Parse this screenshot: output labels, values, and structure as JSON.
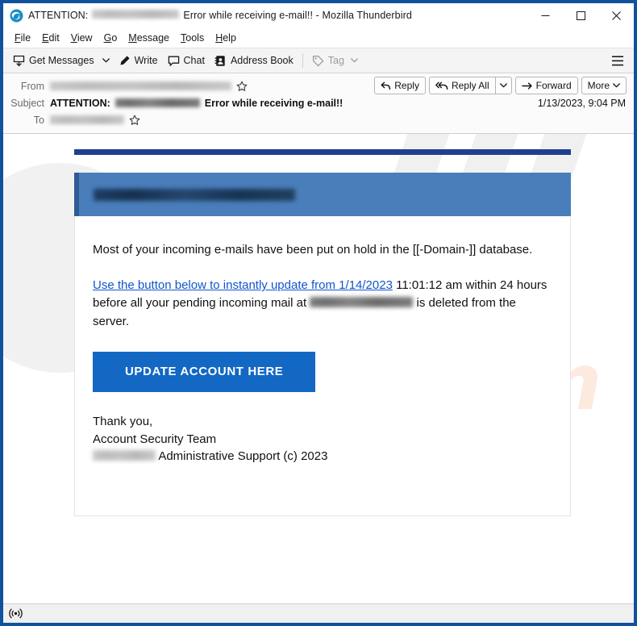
{
  "window": {
    "title_prefix": "ATTENTION:",
    "title_redacted_email": "[redacted-email]",
    "title_suffix": "Error while receiving e-mail!! - Mozilla Thunderbird",
    "app_icon": "thunderbird-icon",
    "controls": {
      "minimize": "minimize-icon",
      "maximize": "maximize-icon",
      "close": "close-icon"
    },
    "frame_color": "#10529e"
  },
  "menubar": {
    "items": [
      {
        "label": "File",
        "accel": "F"
      },
      {
        "label": "Edit",
        "accel": "E"
      },
      {
        "label": "View",
        "accel": "V"
      },
      {
        "label": "Go",
        "accel": "G"
      },
      {
        "label": "Message",
        "accel": "M"
      },
      {
        "label": "Tools",
        "accel": "T"
      },
      {
        "label": "Help",
        "accel": "H"
      }
    ]
  },
  "toolbar": {
    "get_messages": "Get Messages",
    "write": "Write",
    "chat": "Chat",
    "address_book": "Address Book",
    "tag": "Tag",
    "tag_disabled": true,
    "app_menu": "app-menu-icon"
  },
  "message_header": {
    "from_label": "From",
    "from_value": "[redacted sender name and address]",
    "subject_label": "Subject",
    "subject_prefix": "ATTENTION:",
    "subject_redacted": "[redacted-email]",
    "subject_suffix": "Error while receiving e-mail!!",
    "to_label": "To",
    "to_value": "[redacted-email]",
    "date": "1/13/2023, 9:04 PM",
    "actions": {
      "reply": "Reply",
      "reply_all": "Reply All",
      "forward": "Forward",
      "more": "More"
    }
  },
  "email_body": {
    "banner_email": "[redacted-email]",
    "paragraph_1": "Most of your incoming e-mails have been put on hold in the [[-Domain-]] database.",
    "paragraph_2_link": "Use the button below to instantly update from 1/14/2023",
    "paragraph_2_after_link": " 11:01:12 am within 24 hours before all your pending incoming mail at ",
    "paragraph_2_redacted": "[redacted-email]",
    "paragraph_2_tail": " is deleted from the server.",
    "cta_label": "UPDATE ACCOUNT HERE",
    "signature_line_1": "Thank you,",
    "signature_line_2": "Account Security Team",
    "signature_redacted": "[redacted-domain]",
    "signature_line_3": " Administrative Support (c) 2023",
    "accent_bar_color": "#1f3f8f",
    "banner_color": "#4a7ebb",
    "cta_color": "#1268c3",
    "link_color": "#1155cc",
    "watermark_text": "/.com"
  },
  "statusbar": {
    "connection_icon": "connection-icon",
    "text": ""
  }
}
